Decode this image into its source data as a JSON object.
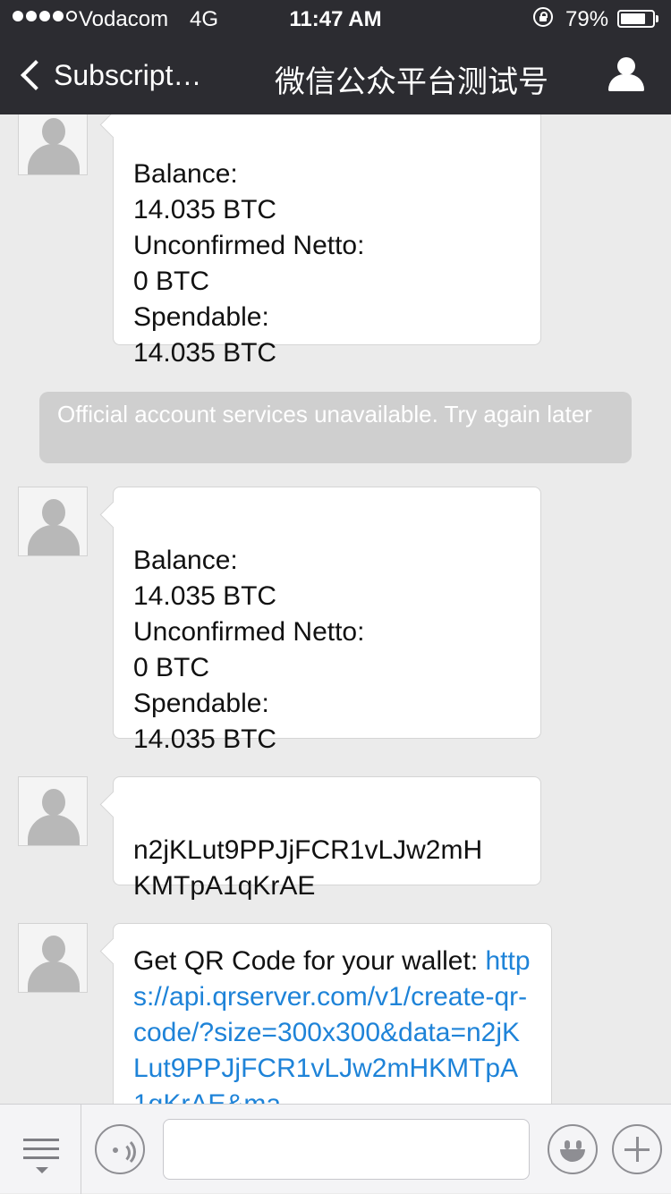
{
  "status_bar": {
    "carrier": "Vodacom",
    "network": "4G",
    "time": "11:47 AM",
    "battery_percent": "79%",
    "battery_level": 0.79,
    "signal_bars_filled": 4,
    "signal_bars_total": 5
  },
  "nav": {
    "back_label": "Subscript…",
    "title": "微信公众平台测试号",
    "back_icon": "chevron-left-icon",
    "profile_icon": "person-icon"
  },
  "messages": [
    {
      "text": "Balance:\n14.035 BTC\nUnconfirmed Netto:\n0 BTC\nSpendable:\n14.035 BTC"
    },
    {
      "text": "Balance:\n14.035 BTC\nUnconfirmed Netto:\n0 BTC\nSpendable:\n14.035 BTC"
    },
    {
      "text": "n2jKLut9PPJjFCR1vLJw2mH\nKMTpA1qKrAE"
    },
    {
      "text": "Get QR Code for your wallet: ",
      "link": "https://api.qrserver.com/v1/create-qr-code/?size=300x300&data=n2jKLut9PPJjFCR1vLJw2mHKMTpA1qKrAE&ma"
    }
  ],
  "system_notice": "Official account services unavailable. Try again later",
  "input_bar": {
    "placeholder": "",
    "menu_icon": "menu-list-icon",
    "voice_icon": "voice-icon",
    "emoji_icon": "emoji-icon",
    "plus_icon": "plus-icon"
  }
}
